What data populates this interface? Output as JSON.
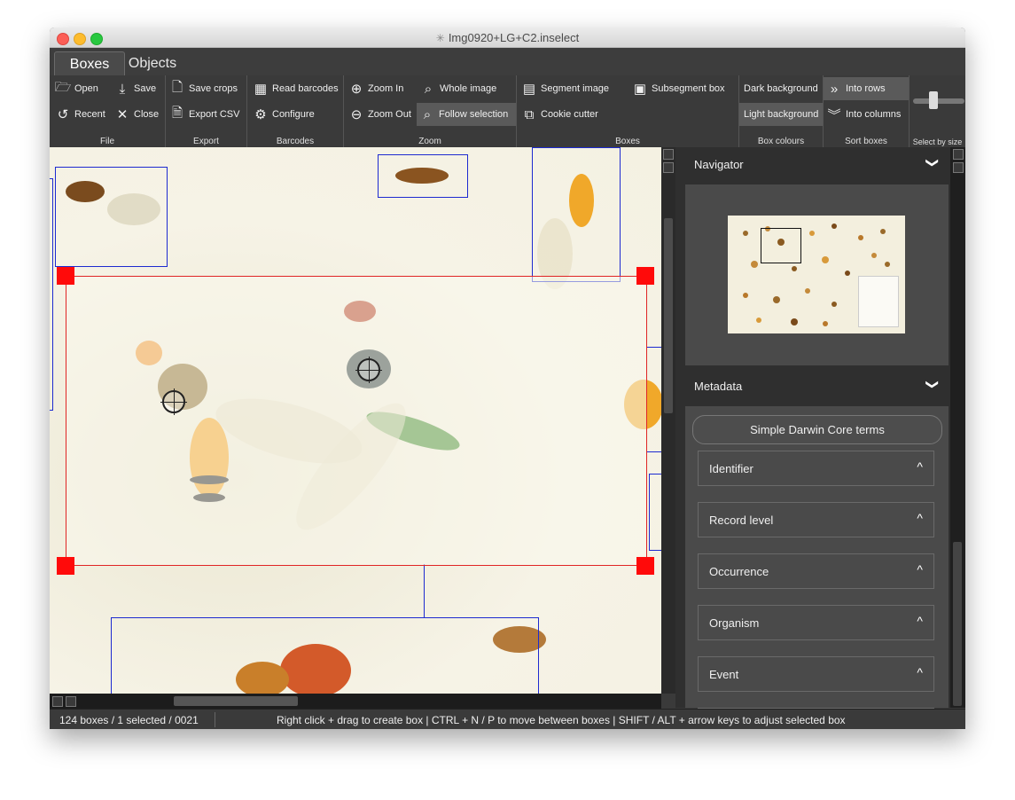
{
  "window": {
    "title": "Img0920+LG+C2.inselect",
    "app_icon": "mosquito-icon"
  },
  "tabs": [
    {
      "label": "Boxes",
      "active": true
    },
    {
      "label": "Objects",
      "active": false
    }
  ],
  "ribbon": {
    "file": {
      "label": "File",
      "open": "Open",
      "save": "Save",
      "recent": "Recent",
      "close": "Close"
    },
    "export": {
      "label": "Export",
      "save_crops": "Save crops",
      "export_csv": "Export CSV"
    },
    "barcodes": {
      "label": "Barcodes",
      "read_barcodes": "Read barcodes",
      "configure": "Configure"
    },
    "zoom": {
      "label": "Zoom",
      "zoom_in": "Zoom In",
      "zoom_out": "Zoom Out",
      "whole_image": "Whole image",
      "follow_selection": "Follow selection"
    },
    "boxes": {
      "label": "Boxes",
      "segment_image": "Segment image",
      "cookie_cutter": "Cookie cutter",
      "subsegment_box": "Subsegment box"
    },
    "box_colours": {
      "label": "Box colours",
      "dark_background": "Dark background",
      "light_background": "Light background"
    },
    "sort_boxes": {
      "label": "Sort boxes",
      "into_rows": "Into rows",
      "into_columns": "Into columns"
    },
    "select_by_size": {
      "label": "Select by size"
    }
  },
  "panel": {
    "navigator": {
      "label": "Navigator"
    },
    "metadata": {
      "label": "Metadata",
      "simple_dwc": "Simple Darwin Core terms",
      "sections": [
        {
          "label": "Identifier"
        },
        {
          "label": "Record level"
        },
        {
          "label": "Occurrence"
        },
        {
          "label": "Organism"
        },
        {
          "label": "Event"
        }
      ]
    }
  },
  "status": {
    "counts": "124 boxes / 1 selected / 0021",
    "hint": "Right click + drag to create box  |  CTRL + N / P to move between boxes  |  SHIFT / ALT + arrow keys to adjust selected box"
  },
  "colors": {
    "selected_box": "#e02525",
    "other_box": "#1d2ad0",
    "handle": "#ff0a0a"
  }
}
